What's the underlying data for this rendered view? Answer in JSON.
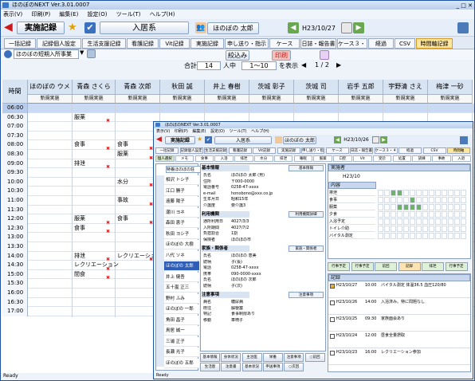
{
  "main": {
    "title": "ほのぼのNEXT Ver.3.01.0007",
    "menu": [
      "表示(V)",
      "印刷(P)",
      "編集(E)",
      "設定(O)",
      "ツール(T)",
      "ヘルプ(H)"
    ],
    "section_title": "実施記録",
    "mode_title": "入居系",
    "user_name": "ほのぼの 太郎",
    "date": "H23/10/27",
    "tabs": [
      "一括記録",
      "記録個人設定",
      "生活支援記録",
      "看護記録",
      "Vit記録",
      "実施記録",
      "申し送り・指示",
      "ケース",
      "日誌・報告書",
      "ケース３・４",
      "経過",
      "CSV",
      "時間軸記録"
    ],
    "active_tab": 12,
    "facility_select": "ほのぼの短期入所事業",
    "filter_button": "絞込み",
    "print_button": "印刷",
    "total_label": "合計",
    "total_count": "14",
    "total_unit": "人中",
    "range": "1〜10",
    "range_unit": "を表示",
    "page": "1 / 2",
    "time_header": "時間",
    "residents": [
      "ほのぼの ウメ",
      "青森 さくら",
      "青森 次郎",
      "秋田 誠",
      "井上 春樹",
      "茨城 彰子",
      "茨城 司",
      "岩手 五郎",
      "宇野清 さえ",
      "梅津 一砂"
    ],
    "sub_label": "新規実施",
    "times": [
      "06:00",
      "06:30",
      "07:00",
      "07:30",
      "08:00",
      "08:30",
      "09:00",
      "09:30",
      "10:00",
      "10:30",
      "11:00",
      "11:30",
      "12:00",
      "12:30",
      "13:00",
      "13:30",
      "14:00",
      "14:30",
      "15:00",
      "15:30",
      "16:00",
      "16:30",
      "17:00"
    ],
    "entries": [
      {
        "row": 1,
        "col": 1,
        "text": "服薬"
      },
      {
        "row": 4,
        "col": 1,
        "text": "食事"
      },
      {
        "row": 4,
        "col": 2,
        "text": "食事"
      },
      {
        "row": 5,
        "col": 2,
        "text": "服薬"
      },
      {
        "row": 6,
        "col": 1,
        "text": "排泄"
      },
      {
        "row": 8,
        "col": 2,
        "text": "水分"
      },
      {
        "row": 10,
        "col": 2,
        "text": "事故"
      },
      {
        "row": 12,
        "col": 1,
        "text": "服薬"
      },
      {
        "row": 12,
        "col": 2,
        "text": "食事"
      },
      {
        "row": 13,
        "col": 1,
        "text": "食事"
      },
      {
        "row": 16,
        "col": 1,
        "text": "排泄"
      },
      {
        "row": 16,
        "col": 2,
        "text": "レクリエーション"
      },
      {
        "row": 17,
        "col": 1,
        "text": "レクリエーション"
      },
      {
        "row": 18,
        "col": 1,
        "text": "間食"
      }
    ],
    "status": "Ready"
  },
  "sub": {
    "title": "ほのぼのNEXT Ver.3.01.0007",
    "menu": [
      "表示(V)",
      "印刷(P)",
      "編集(E)",
      "設定(O)",
      "ツール(T)",
      "ヘルプ(H)"
    ],
    "section_title": "実施記録",
    "mode_title": "入居系",
    "user_name": "ほのぼの 太郎",
    "date": "H23/10/26",
    "tabs": [
      "一括記録",
      "記録個人設定",
      "生活支援記録",
      "看護記録",
      "Vit記録",
      "実施記録",
      "申し送り・指示",
      "ケース",
      "日誌・報告書",
      "ケース３・４",
      "経過",
      "CSV",
      "時間軸"
    ],
    "subtabs": [
      "個人選択",
      "メモ",
      "食事",
      "入浴",
      "排泄",
      "水分",
      "排泄",
      "睡眠",
      "服薬",
      "口腔",
      "Vit",
      "受診",
      "処置",
      "訓練",
      "事故",
      "入退"
    ],
    "facility_select": "特養ほのぼの荘",
    "residents": [
      "相沢 トシ子",
      "江口 勝子",
      "遠藤 陽子",
      "潮川 ヨネ",
      "森田 恵子",
      "秋田 ヨシ子",
      "ほのぼの 大樹",
      "八代 ソネ",
      "ほのぼの 太郎",
      "井上 健吾",
      "五十嵐 正三",
      "野村 ふみ",
      "ほのぼの 一郎",
      "角田 昌子",
      "鳥居 誠一",
      "三浦 正子",
      "長瀬 光子",
      "ほのぼの 五郎"
    ],
    "selected_resident": 8,
    "info_sections": [
      {
        "title": "基本情報",
        "button": "基本情報",
        "rows": [
          [
            "氏名",
            "ほのぼの 太郎 (男)"
          ],
          [
            "住所",
            "〒000-0000"
          ],
          [
            "電話番号",
            "0258-47-xxxx"
          ],
          [
            "e-mail",
            "honobono@xxx.co.jp"
          ],
          [
            "生年月日",
            "昭和15年"
          ],
          [
            "介護度",
            "要介護3"
          ]
        ]
      },
      {
        "title": "利用機関",
        "button": "利用機関詳細",
        "rows": [
          [
            "通所利用日",
            "4027/3/3"
          ],
          [
            "入所期間",
            "4027/7/2"
          ],
          [
            "負担割合",
            "1割"
          ],
          [
            "保険者",
            "ほのぼの市"
          ]
        ]
      },
      {
        "title": "家族・関係者",
        "button": "家族・関係者",
        "rows": [
          [
            "氏名",
            "ほのぼの 恵美"
          ],
          [
            "続柄",
            "子(長)"
          ],
          [
            "電話",
            "0258-47-xxxx"
          ],
          [
            "携帯",
            "090-0000-xxxx"
          ],
          [
            "氏名",
            "ほのぼの 次郎"
          ],
          [
            "続柄",
            "子(次)"
          ]
        ]
      },
      {
        "title": "注意事項",
        "button": "注意事項",
        "rows": [
          [
            "病名",
            "糖尿病"
          ],
          [
            "既往",
            "脳梗塞"
          ],
          [
            "特記",
            "食事制限あり"
          ],
          [
            "移動",
            "車椅子"
          ]
        ]
      }
    ],
    "bottom_buttons": [
      "基本情報",
      "身体状況",
      "主治医",
      "栄養",
      "注意事項",
      "○前回",
      "生活歴",
      "注意書",
      "基本状況",
      "申送事項",
      "○次回"
    ],
    "calendar_title": "実施者",
    "calendar_month": "H23/10",
    "calendar_rows": [
      "排泄",
      "食事",
      "服薬",
      "夕食",
      "入浴予定",
      "トイレ介助",
      "バイタル測定"
    ],
    "schedule_header": "内容",
    "record_header": "記録",
    "right_buttons": [
      "行事予定",
      "行事予定",
      "前回",
      "記録",
      "排泄",
      "行事予定"
    ],
    "log_entries": [
      {
        "date": "H23/10/27",
        "time": "10:00",
        "text": "バイタル測定 体温36.5 血圧120/80"
      },
      {
        "date": "H23/10/26",
        "time": "14:00",
        "text": "入浴済み。特に問題なし"
      },
      {
        "date": "H23/10/25",
        "time": "09:30",
        "text": "家族面会あり"
      },
      {
        "date": "H23/10/24",
        "time": "12:00",
        "text": "昼食全量摂取"
      },
      {
        "date": "H23/10/23",
        "time": "16:00",
        "text": "レクリエーション参加"
      }
    ],
    "status": "Ready"
  }
}
